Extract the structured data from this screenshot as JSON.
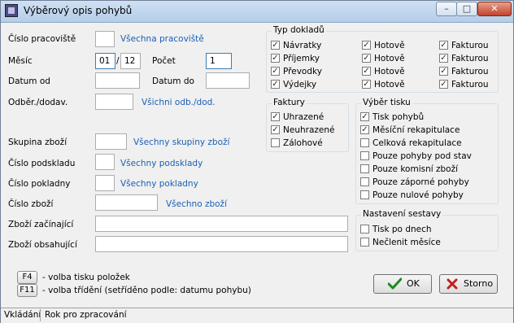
{
  "window": {
    "title": "Výběrový opis pohybů",
    "minimize_glyph": "–",
    "maximize_glyph": "□",
    "close_glyph": "✕"
  },
  "form": {
    "worker": {
      "label": "Číslo pracoviště",
      "value": "",
      "link": "Všechna pracoviště"
    },
    "month": {
      "label": "Měsíc",
      "from": "01",
      "sep": "/",
      "to": "12",
      "count_label": "Počet",
      "count_value": "1"
    },
    "date": {
      "from_label": "Datum od",
      "from_value": "",
      "to_label": "Datum do",
      "to_value": ""
    },
    "partner": {
      "label": "Odběr./dodav.",
      "value": "",
      "link": "Všichni odb./dod."
    },
    "group": {
      "label": "Skupina zboží",
      "value": "",
      "link": "Všechny skupiny zboží"
    },
    "substore": {
      "label": "Číslo podskladu",
      "value": "",
      "link": "Všechny podsklady"
    },
    "till": {
      "label": "Číslo pokladny",
      "value": "",
      "link": "Všechny pokladny"
    },
    "goods": {
      "label": "Číslo zboží",
      "value": "",
      "link": "Všechno zboží"
    },
    "starts": {
      "label": "Zboží začínající",
      "value": ""
    },
    "contains": {
      "label": "Zboží obsahující",
      "value": ""
    }
  },
  "doc_types": {
    "title": "Typ dokladů",
    "col1": [
      {
        "label": "Návratky",
        "checked": true
      },
      {
        "label": "Příjemky",
        "checked": true
      },
      {
        "label": "Převodky",
        "checked": true
      },
      {
        "label": "Výdejky",
        "checked": true
      }
    ],
    "col2": [
      {
        "label": "Hotově",
        "checked": true
      },
      {
        "label": "Hotově",
        "checked": true
      },
      {
        "label": "Hotově",
        "checked": true
      },
      {
        "label": "Hotově",
        "checked": true
      }
    ],
    "col3": [
      {
        "label": "Fakturou",
        "checked": true
      },
      {
        "label": "Fakturou",
        "checked": true
      },
      {
        "label": "Fakturou",
        "checked": true
      },
      {
        "label": "Fakturou",
        "checked": true
      }
    ]
  },
  "invoices": {
    "title": "Faktury",
    "items": [
      {
        "label": "Uhrazené",
        "checked": true
      },
      {
        "label": "Neuhrazené",
        "checked": true
      },
      {
        "label": "Zálohové",
        "checked": false
      }
    ]
  },
  "print_select": {
    "title": "Výběr tisku",
    "items": [
      {
        "label": "Tisk pohybů",
        "checked": true
      },
      {
        "label": "Měsíční rekapitulace",
        "checked": true
      },
      {
        "label": "Celková rekapitulace",
        "checked": false
      },
      {
        "label": "Pouze pohyby pod stav",
        "checked": false
      },
      {
        "label": "Pouze komisní zboží",
        "checked": false
      },
      {
        "label": "Pouze záporné pohyby",
        "checked": false
      },
      {
        "label": "Pouze nulové pohyby",
        "checked": false
      }
    ]
  },
  "settings": {
    "title": "Nastavení sestavy",
    "items": [
      {
        "label": "Tisk po dnech",
        "checked": false
      },
      {
        "label": "Nečlenit měsíce",
        "checked": false
      }
    ]
  },
  "hints": [
    {
      "key": "F4",
      "text": "- volba tisku položek"
    },
    {
      "key": "F11",
      "text": "- volba třídění (setříděno podle: datumu pohybu)"
    }
  ],
  "buttons": {
    "ok": "OK",
    "cancel": "Storno"
  },
  "status": {
    "mode": "Vkládání",
    "message": "Rok pro zpracování"
  }
}
